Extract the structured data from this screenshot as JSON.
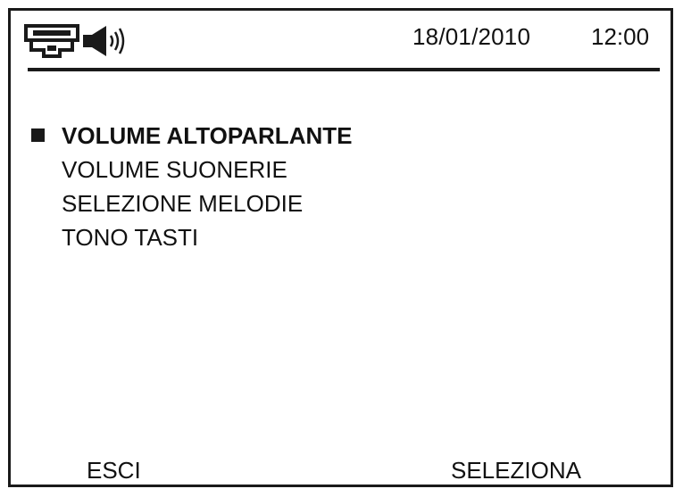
{
  "status_bar": {
    "icons": [
      "network-plug-icon",
      "speaker-volume-icon"
    ],
    "date": "18/01/2010",
    "time": "12:00"
  },
  "menu": {
    "items": [
      {
        "label": "VOLUME ALTOPARLANTE",
        "selected": true
      },
      {
        "label": "VOLUME SUONERIE",
        "selected": false
      },
      {
        "label": "SELEZIONE MELODIE",
        "selected": false
      },
      {
        "label": "TONO TASTI",
        "selected": false
      }
    ]
  },
  "softkeys": {
    "left": "ESCI",
    "right": "SELEZIONA"
  }
}
